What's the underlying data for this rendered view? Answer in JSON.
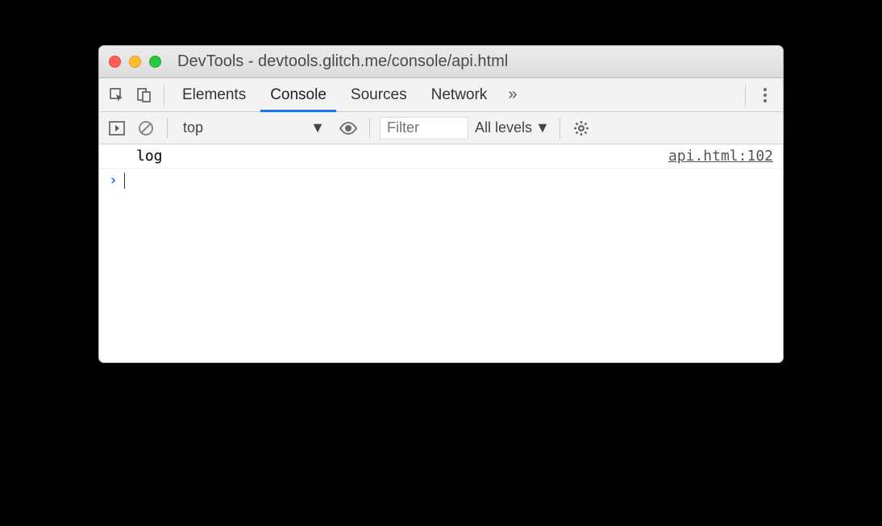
{
  "window": {
    "title": "DevTools - devtools.glitch.me/console/api.html"
  },
  "tabs": {
    "elements": "Elements",
    "console": "Console",
    "sources": "Sources",
    "network": "Network",
    "overflow": "»"
  },
  "filterbar": {
    "context": "top",
    "filter_placeholder": "Filter",
    "levels": "All levels"
  },
  "console": {
    "log_message": "log",
    "log_source": "api.html:102",
    "prompt": "›"
  }
}
